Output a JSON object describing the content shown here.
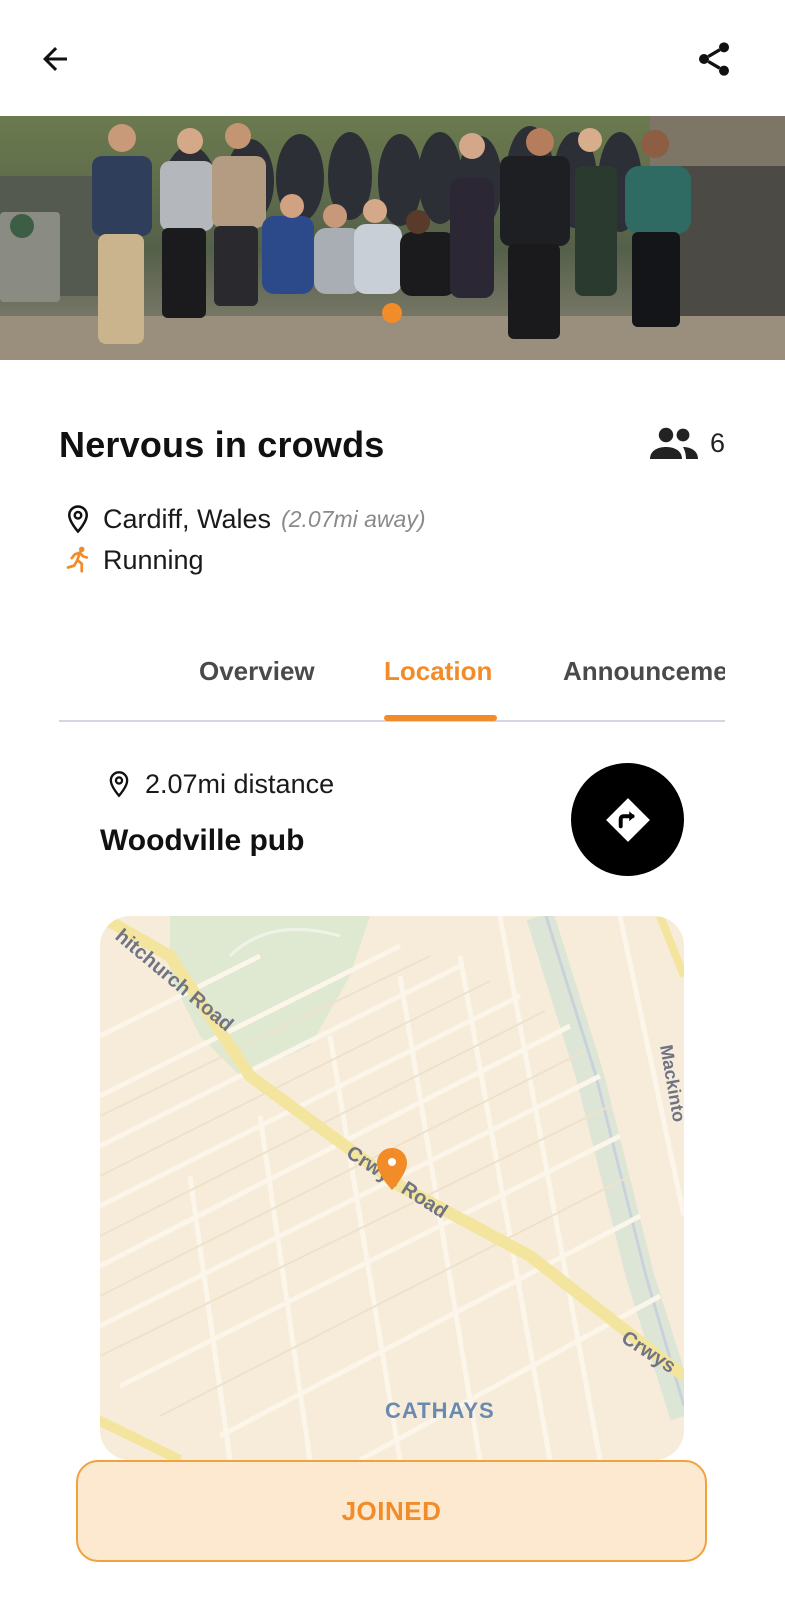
{
  "group": {
    "title": "Nervous in crowds",
    "member_count": "6",
    "location": "Cardiff, Wales",
    "distance_away": "(2.07mi away)",
    "activity": "Running"
  },
  "tabs": [
    {
      "label": "Overview",
      "active": false
    },
    {
      "label": "Location",
      "active": true
    },
    {
      "label": "Announceme",
      "active": false
    }
  ],
  "location_panel": {
    "distance": "2.07mi distance",
    "venue": "Woodville pub"
  },
  "map": {
    "road_labels": [
      "hitchurch Road",
      "Crwys Road",
      "Crwys",
      "Mackinto"
    ],
    "district_label": "CATHAYS"
  },
  "action": {
    "joined_label": "JOINED"
  },
  "colors": {
    "accent": "#f28c28",
    "joined_bg": "#fde9d0",
    "tab_line": "#d8d4e2",
    "map_bg": "#f7ecd9",
    "map_road_main": "#f3e59e"
  },
  "icons": {
    "back": "arrow-left-icon",
    "share": "share-icon",
    "members": "group-icon",
    "location": "location-pin-icon",
    "activity": "running-icon",
    "directions": "directions-icon",
    "map_marker": "map-marker-icon"
  }
}
